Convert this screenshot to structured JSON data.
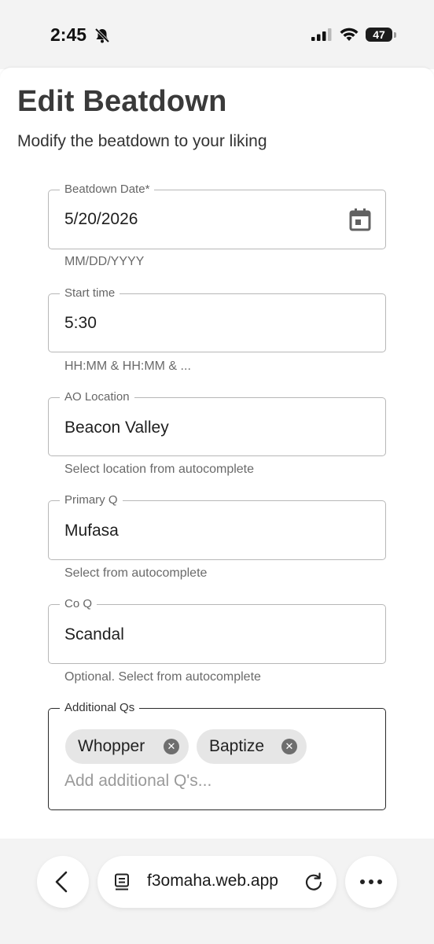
{
  "status_bar": {
    "time": "2:45",
    "battery": "47"
  },
  "page": {
    "title": "Edit Beatdown",
    "subtitle": "Modify the beatdown to your liking"
  },
  "fields": {
    "date": {
      "label": "Beatdown Date*",
      "value": "5/20/2026",
      "helper": "MM/DD/YYYY"
    },
    "start_time": {
      "label": "Start time",
      "value": "5:30",
      "helper": "HH:MM & HH:MM & ..."
    },
    "ao_location": {
      "label": "AO Location",
      "value": "Beacon Valley",
      "helper": "Select location from autocomplete"
    },
    "primary_q": {
      "label": "Primary Q",
      "value": "Mufasa",
      "helper": "Select from autocomplete"
    },
    "co_q": {
      "label": "Co Q",
      "value": "Scandal",
      "helper": "Optional. Select from autocomplete"
    },
    "additional_qs": {
      "label": "Additional Qs",
      "chips": [
        "Whopper",
        "Baptize"
      ],
      "placeholder": "Add additional Q's..."
    }
  },
  "browser": {
    "url": "f3omaha.web.app"
  },
  "icons": {
    "calendar": "calendar-icon",
    "chip_remove": "close-circle-icon",
    "back": "chevron-left-icon",
    "tabs": "tab-list-icon",
    "reload": "reload-icon",
    "more": "more-horizontal-icon"
  }
}
